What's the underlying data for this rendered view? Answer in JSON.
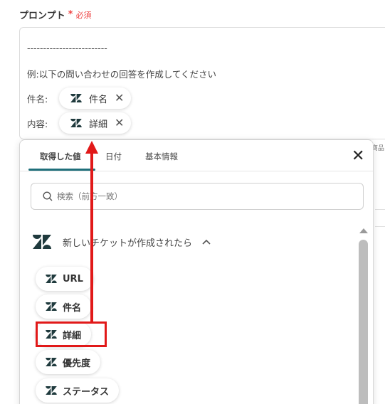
{
  "field": {
    "label": "プロンプト",
    "required_star": "*",
    "required_text": "必須"
  },
  "textarea": {
    "divider": "-------------------------",
    "instruction": "例:以下の問い合わせの回答を作成してください",
    "subject_label": "件名:",
    "content_label": "内容:",
    "chips": [
      {
        "label": "件名",
        "close": "✕"
      },
      {
        "label": "詳細",
        "close": "✕"
      }
    ]
  },
  "background_right_text": "商品",
  "panel": {
    "tabs": [
      "取得した値",
      "日付",
      "基本情報"
    ],
    "active_tab": "取得した値",
    "close": "✕",
    "search_placeholder": "検索（前方一致）",
    "group_title": "新しいチケットが作成されたら",
    "items": [
      "URL",
      "件名",
      "詳細",
      "優先度",
      "ステータス"
    ],
    "highlighted_item": "詳細"
  },
  "colors": {
    "required": "#ee4444",
    "accent_tab": "#1f6f7a",
    "annotation": "#e11919",
    "zendesk_logo": "#1f3a3d"
  },
  "icons": {
    "chip_logo": "zendesk-icon",
    "search": "search-icon",
    "chevron": "chevron-up-icon",
    "close": "close-icon"
  }
}
